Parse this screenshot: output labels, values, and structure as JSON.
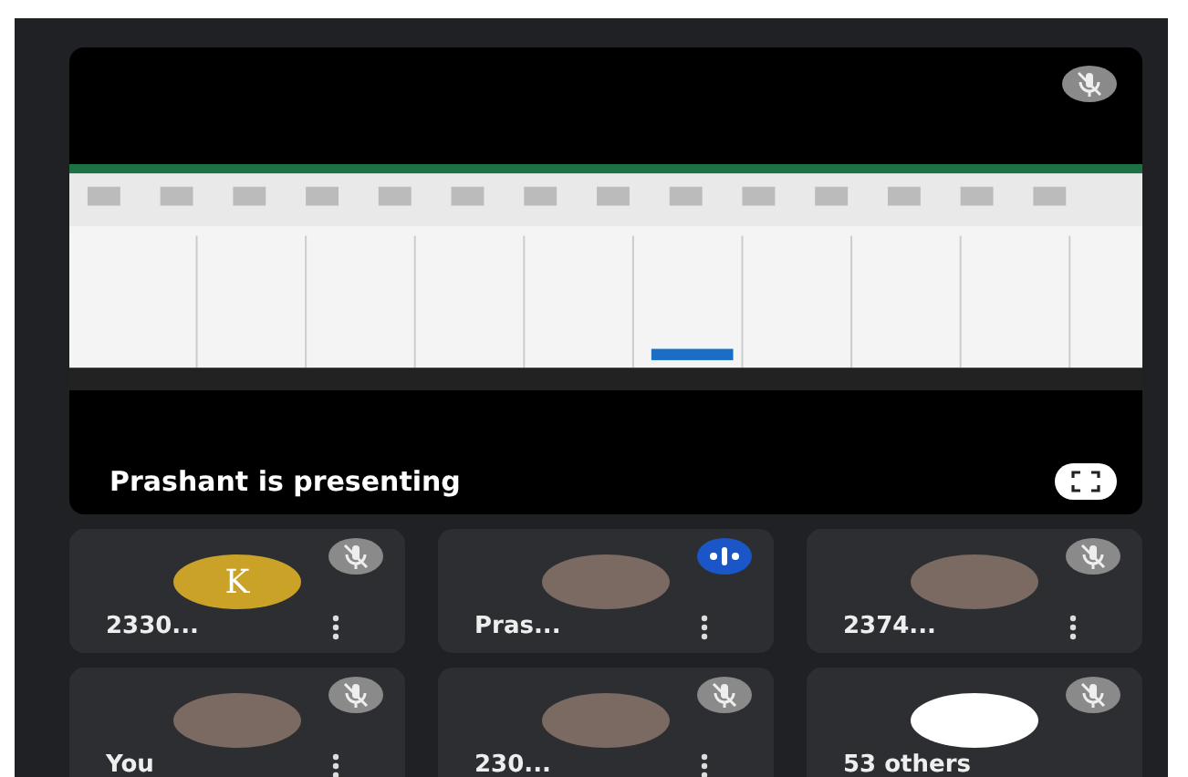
{
  "presentation": {
    "caption": "Prashant is presenting",
    "muted": true
  },
  "tiles": [
    {
      "kind": "initial",
      "name": "2330...",
      "initial": "K",
      "speaking": false
    },
    {
      "kind": "photo",
      "name": "Pras...",
      "speaking": true
    },
    {
      "kind": "photo",
      "name": "2374...",
      "speaking": false
    },
    {
      "kind": "photo",
      "name": "You",
      "speaking": false
    },
    {
      "kind": "photo",
      "name": "230...",
      "speaking": false
    },
    {
      "kind": "others",
      "name": "53 others",
      "speaking": false
    }
  ]
}
